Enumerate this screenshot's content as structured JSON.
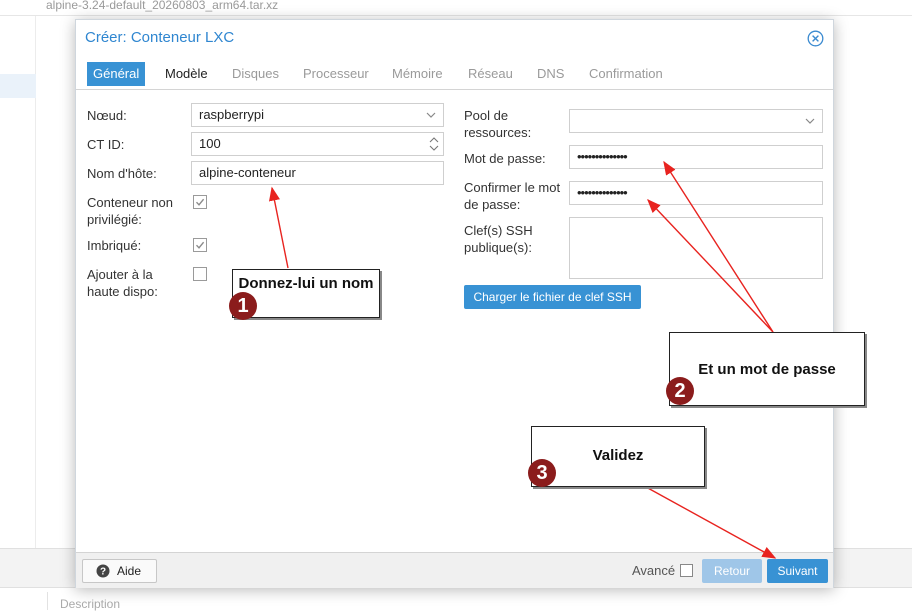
{
  "background": {
    "filename": "alpine-3.24-default_20260803_arm64.tar.xz",
    "left_tick": "·",
    "bottom_label": "Description"
  },
  "dialog": {
    "title": "Créer: Conteneur LXC",
    "close_icon": "close-circle-icon",
    "tabs": [
      {
        "label": "Général",
        "state": "active"
      },
      {
        "label": "Modèle",
        "state": "enabled"
      },
      {
        "label": "Disques",
        "state": "disabled"
      },
      {
        "label": "Processeur",
        "state": "disabled"
      },
      {
        "label": "Mémoire",
        "state": "disabled"
      },
      {
        "label": "Réseau",
        "state": "disabled"
      },
      {
        "label": "DNS",
        "state": "disabled"
      },
      {
        "label": "Confirmation",
        "state": "disabled"
      }
    ],
    "left": {
      "noeud_label": "Nœud:",
      "noeud_value": "raspberrypi",
      "ctid_label": "CT ID:",
      "ctid_value": "100",
      "hostname_label": "Nom d'hôte:",
      "hostname_value": "alpine-conteneur",
      "unpriv_label": "Conteneur non privilégié:",
      "unpriv_checked": true,
      "nesting_label": "Imbriqué:",
      "nesting_checked": true,
      "ha_label": "Ajouter à la haute dispo:",
      "ha_checked": false
    },
    "right": {
      "pool_label": "Pool de ressources:",
      "pool_value": "",
      "password_label": "Mot de passe:",
      "password_value": "••••••••••••••",
      "confirm_label": "Confirmer le mot de passe:",
      "confirm_value": "••••••••••••••",
      "ssh_label": "Clef(s) SSH publique(s):",
      "ssh_value": "",
      "ssh_button": "Charger le fichier de clef SSH"
    },
    "footer": {
      "help_label": "Aide",
      "advanced_label": "Avancé",
      "advanced_checked": false,
      "back_label": "Retour",
      "next_label": "Suivant"
    }
  },
  "annotations": {
    "callout1": {
      "number": "1",
      "text": "Donnez-lui un nom"
    },
    "callout2": {
      "number": "2",
      "text": "Et un mot de passe"
    },
    "callout3": {
      "number": "3",
      "text": "Validez"
    },
    "arrow_color": "#e8231f",
    "badge_color": "#8b1c1c"
  },
  "colors": {
    "accent": "#3892d4",
    "title": "#2f86d0",
    "disabled_button": "#9fc6e8"
  }
}
